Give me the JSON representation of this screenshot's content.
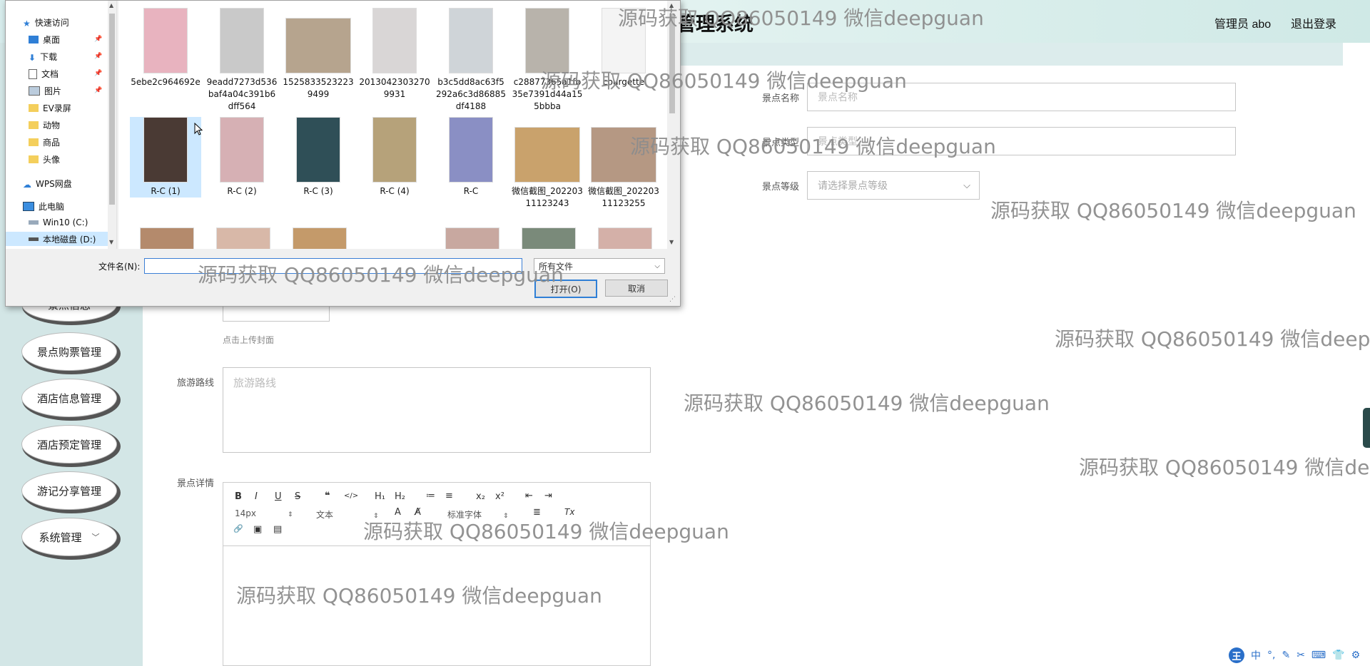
{
  "app": {
    "title_visible": "管理系统",
    "user_label": "管理员 abo",
    "logout_label": "退出登录"
  },
  "sidebar": {
    "items": [
      {
        "label": "景点信息"
      },
      {
        "label": "景点购票管理"
      },
      {
        "label": "酒店信息管理"
      },
      {
        "label": "酒店预定管理"
      },
      {
        "label": "游记分享管理"
      },
      {
        "label": "系统管理"
      }
    ]
  },
  "form": {
    "name_label": "景点名称",
    "name_placeholder": "景点名称",
    "type_label": "景点类型",
    "type_placeholder": "景点类型",
    "level_label": "景点等级",
    "level_placeholder": "请选择景点等级",
    "upload_hint": "点击上传封面",
    "route_label": "旅游路线",
    "route_placeholder": "旅游路线",
    "detail_label": "景点详情"
  },
  "editor": {
    "font_size": "14px",
    "text_style": "文本",
    "font_family": "标准字体",
    "buttons": [
      "B",
      "I",
      "U",
      "S",
      "❝",
      "</>",
      "H₁",
      "H₂",
      "≔",
      "≡",
      "x₂",
      "x²",
      "⇤",
      "⇥",
      "A",
      "A̸",
      "≣",
      "Tx",
      "🔗",
      "▣",
      "▤"
    ]
  },
  "watermark": "源码获取 QQ86050149 微信deepguan",
  "dialog": {
    "nav": [
      {
        "label": "快速访问",
        "icon": "star-icon",
        "pinned": false
      },
      {
        "label": "桌面",
        "icon": "desktop-icon",
        "pinned": true
      },
      {
        "label": "下载",
        "icon": "download-icon",
        "pinned": true
      },
      {
        "label": "文档",
        "icon": "document-icon",
        "pinned": true
      },
      {
        "label": "图片",
        "icon": "pictures-icon",
        "pinned": true
      },
      {
        "label": "EV录屏",
        "icon": "folder-icon",
        "pinned": false
      },
      {
        "label": "动物",
        "icon": "folder-icon",
        "pinned": false
      },
      {
        "label": "商品",
        "icon": "folder-icon",
        "pinned": false
      },
      {
        "label": "头像",
        "icon": "folder-icon",
        "pinned": false
      },
      {
        "label": "WPS网盘",
        "icon": "cloud-icon",
        "pinned": false
      },
      {
        "label": "此电脑",
        "icon": "computer-icon",
        "pinned": false
      },
      {
        "label": "Win10 (C:)",
        "icon": "drive-icon",
        "pinned": false
      },
      {
        "label": "本地磁盘 (D:)",
        "icon": "drive-icon",
        "pinned": false
      }
    ],
    "files": [
      {
        "name": "5ebe2c964692e",
        "color": "#e8b3bf"
      },
      {
        "name": "9eadd7273d536baf4a04c391b6dff564",
        "color": "#c9c9c9"
      },
      {
        "name": "15258335232239499",
        "color": "#b6a48e"
      },
      {
        "name": "20130423032709931",
        "color": "#d9d6d6"
      },
      {
        "name": "b3c5dd8ac63f5292a6c3d86885df4188",
        "color": "#cfd4d8"
      },
      {
        "name": "c28877365a1fb35e7391d44a155bbba",
        "color": "#b8b3ab"
      },
      {
        "name": "courgette",
        "color": "#f4f4f4"
      },
      {
        "name": "R-C (1)",
        "color": "#4a3a34"
      },
      {
        "name": "R-C (2)",
        "color": "#d6b0b4"
      },
      {
        "name": "R-C (3)",
        "color": "#2f4f57"
      },
      {
        "name": "R-C (4)",
        "color": "#b6a27a"
      },
      {
        "name": "R-C",
        "color": "#8a8fc4"
      },
      {
        "name": "微信截图_20220311123243",
        "color": "#c9a26c"
      },
      {
        "name": "微信截图_20220311123255",
        "color": "#b59883"
      }
    ],
    "filename_label": "文件名(N):",
    "filename_value": "",
    "filter_value": "所有文件",
    "open_label": "打开(O)",
    "cancel_label": "取消"
  },
  "tray": {
    "ime": "王",
    "items": [
      "中",
      "°,",
      "✎",
      "✂",
      "⌨",
      "👕",
      "⚙"
    ]
  }
}
